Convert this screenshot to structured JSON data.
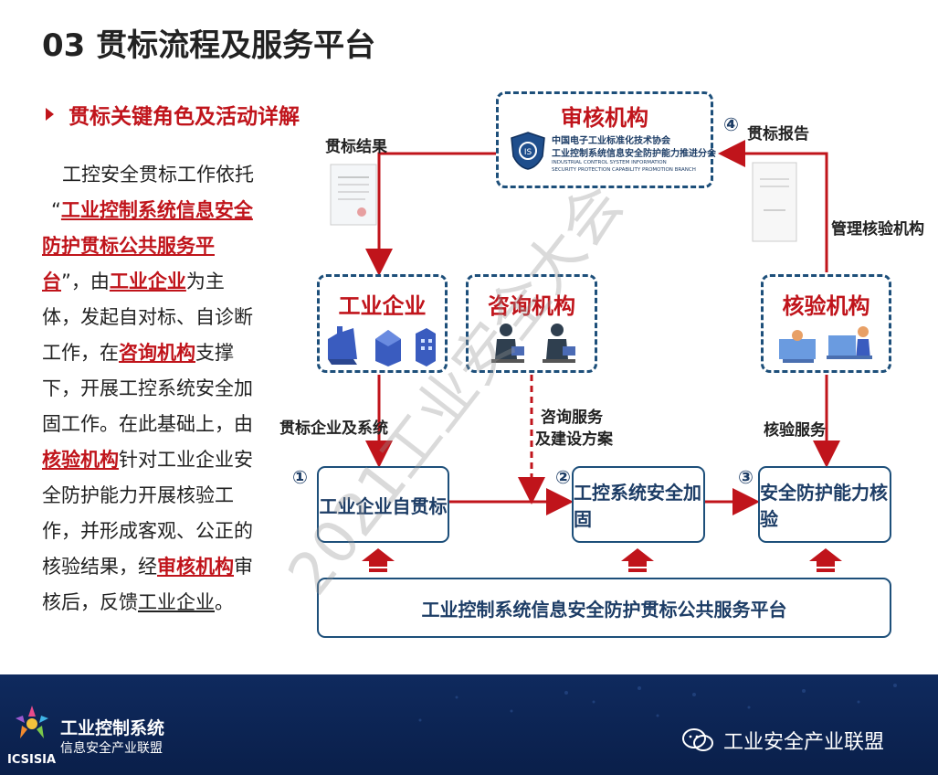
{
  "header": {
    "title": "03 贯标流程及服务平台"
  },
  "subtitle": "贯标关键角色及活动详解",
  "body": {
    "p1": "工控安全贯标工作依托",
    "q_open": "“",
    "platform": "工业控制系统信息安全防护贯标公共服务平台",
    "q_close": "”，由",
    "enterprise": "工业企业",
    "t2": "为主体，发起自对标、自诊断工作，在",
    "consult": "咨询机构",
    "t3": "支撑下，开展工控系统安全加固工作。在此基础上，由",
    "verify": "核验机构",
    "t4": "针对工业企业安全防护能力开展核验工作，并形成客观、公正的核验结果，经",
    "audit": "审核机构",
    "t5": "审核后，反馈",
    "t6": "工业企业",
    "t7": "。"
  },
  "diagram": {
    "audit_box": {
      "title": "审核机构",
      "org_line1": "中国电子工业标准化技术协会",
      "org_line2": "工业控制系统信息安全防护能力推进分会",
      "org_line3": "INDUSTRIAL CONTROL SYSTEM INFORMATION",
      "org_line4": "SECURITY PROTECTION CAPABILITY PROMOTION BRANCH"
    },
    "enterprise_box": {
      "title": "工业企业"
    },
    "consult_box": {
      "title": "咨询机构"
    },
    "verify_box": {
      "title": "核验机构"
    },
    "step1": {
      "num": "①",
      "label": "工业企业自贯标"
    },
    "step2": {
      "num": "②",
      "label": "工控系统安全加固"
    },
    "step3": {
      "num": "③",
      "label": "安全防护能力核验"
    },
    "step4_num": "④",
    "platform": "工业控制系统信息安全防护贯标公共服务平台",
    "labels": {
      "result": "贯标结果",
      "report": "贯标报告",
      "manage": "管理核验机构",
      "enterprise_sys": "贯标企业及系统",
      "consult_service_1": "咨询服务",
      "consult_service_2": "及建设方案",
      "verify_service": "核验服务"
    }
  },
  "watermark": "2021工业安全大会",
  "footer": {
    "logo_line1": "工业控制系统",
    "logo_line2": "信息安全产业联盟",
    "logo_abbr": "ICSISIA",
    "wechat": "工业安全产业联盟"
  },
  "colors": {
    "red": "#c0141b",
    "navy": "#1d4f7a",
    "footer": "#0f2a5e"
  }
}
